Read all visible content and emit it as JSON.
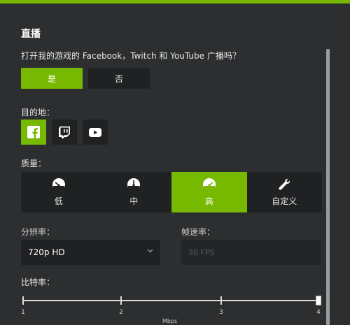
{
  "colors": {
    "accent": "#76b900",
    "background": "#2c2e30",
    "control": "#1f2123"
  },
  "header": {
    "title": "直播"
  },
  "broadcast": {
    "question": "打开我的游戏的 Facebook，Twitch 和 YouTube 广播吗？",
    "options": [
      {
        "label": "是",
        "selected": true
      },
      {
        "label": "否",
        "selected": false
      }
    ]
  },
  "destination": {
    "label": "目的地：",
    "items": [
      {
        "icon": "facebook-icon",
        "selected": true
      },
      {
        "icon": "twitch-icon",
        "selected": false
      },
      {
        "icon": "youtube-icon",
        "selected": false
      }
    ]
  },
  "quality": {
    "label": "质量：",
    "items": [
      {
        "label": "低",
        "icon": "gauge-low-icon",
        "selected": false
      },
      {
        "label": "中",
        "icon": "gauge-medium-icon",
        "selected": false
      },
      {
        "label": "高",
        "icon": "gauge-high-icon",
        "selected": true
      },
      {
        "label": "自定义",
        "icon": "wrench-icon",
        "selected": false
      }
    ]
  },
  "resolution": {
    "label": "分辨率：",
    "value": "720p HD"
  },
  "framerate": {
    "label": "帧速率：",
    "value": "30 FPS"
  },
  "bitrate": {
    "label": "比特率：",
    "ticks": [
      "1",
      "2",
      "3",
      "4"
    ],
    "unit": "Mbps",
    "value": 4
  }
}
